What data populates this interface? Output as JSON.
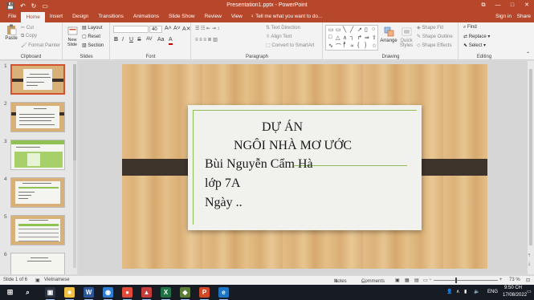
{
  "window": {
    "title": "Presentation1.pptx - PowerPoint",
    "qat": {
      "save": "💾",
      "undo": "↶",
      "redo": "↻",
      "present": "▭"
    },
    "controls": {
      "restore": "⧉",
      "minimize": "—",
      "maximize": "□",
      "close": "✕"
    }
  },
  "tabs": [
    "File",
    "Home",
    "Insert",
    "Design",
    "Transitions",
    "Animations",
    "Slide Show",
    "Review",
    "View"
  ],
  "active_tab": "Home",
  "tell_me": "♀ Tell me what you want to do...",
  "sign_in": "Sign in",
  "share": "Share",
  "ribbon": {
    "clipboard": {
      "label": "Clipboard",
      "paste": "Paste",
      "cut": "Cut",
      "copy": "Copy",
      "format_painter": "Format Painter"
    },
    "slides": {
      "label": "Slides",
      "new_slide": "New Slide",
      "layout": "Layout",
      "reset": "Reset",
      "section": "Section"
    },
    "font": {
      "label": "Font",
      "size": "40",
      "bold": "B",
      "italic": "I",
      "underline": "U",
      "strike": "S",
      "spacing": "AV",
      "case": "Aa",
      "color": "A",
      "grow": "A˄",
      "shrink": "A˅",
      "clear": "A✕"
    },
    "paragraph": {
      "label": "Paragraph",
      "text_direction": "Text Direction",
      "align_text": "Align Text",
      "smartart": "Convert to SmartArt"
    },
    "drawing": {
      "label": "Drawing",
      "arrange": "Arrange",
      "quick_styles": "Quick Styles",
      "shape_fill": "Shape Fill",
      "shape_outline": "Shape Outline",
      "shape_effects": "Shape Effects",
      "shapes": [
        "▭",
        "▭",
        "╲",
        "╱",
        "↗",
        "▯",
        "○",
        "□",
        "△",
        "∧",
        "┐",
        "↱",
        "⇒",
        "⇧",
        "∿",
        "⌒",
        "⳨",
        "∝",
        "{",
        "}",
        "☆"
      ]
    },
    "editing": {
      "label": "Editing",
      "find": "Find",
      "replace": "Replace",
      "select": "Select"
    }
  },
  "thumbnails": [
    {
      "num": "1",
      "selected": true
    },
    {
      "num": "2",
      "selected": false
    },
    {
      "num": "3",
      "selected": false
    },
    {
      "num": "4",
      "selected": false
    },
    {
      "num": "5",
      "selected": false
    },
    {
      "num": "6",
      "selected": false
    }
  ],
  "slide": {
    "line1": "DỰ ÁN",
    "line2": "NGÔI NHÀ MƠ ƯỚC",
    "line3": "Bùi Nguyễn Cẩm Hà",
    "line4": "lớp 7A",
    "line5": "Ngày .."
  },
  "status": {
    "slide_of": "Slide 1 of 6",
    "language": "Vietnamese",
    "notes": "Notes",
    "comments": "Comments",
    "zoom": "73 %",
    "zoom_value_pct": 73
  },
  "taskbar": {
    "start": "⊞",
    "search": "⌕",
    "apps": [
      {
        "name": "task-view",
        "glyph": "▣",
        "color": "#2a3140"
      },
      {
        "name": "files",
        "glyph": "■",
        "color": "#f0c040"
      },
      {
        "name": "word",
        "glyph": "W",
        "color": "#2b579a"
      },
      {
        "name": "browser",
        "glyph": "◉",
        "color": "#2f7dd1"
      },
      {
        "name": "chrome",
        "glyph": "●",
        "color": "#de4b39"
      },
      {
        "name": "media",
        "glyph": "▲",
        "color": "#c43c3c"
      },
      {
        "name": "excel",
        "glyph": "X",
        "color": "#1f7244"
      },
      {
        "name": "app",
        "glyph": "◆",
        "color": "#5a7d3a"
      },
      {
        "name": "powerpoint",
        "glyph": "P",
        "color": "#d24726"
      },
      {
        "name": "edge",
        "glyph": "e",
        "color": "#1e74c4"
      }
    ],
    "lang": "ENG",
    "time": "9:50 CH",
    "date": "17/08/2022"
  }
}
